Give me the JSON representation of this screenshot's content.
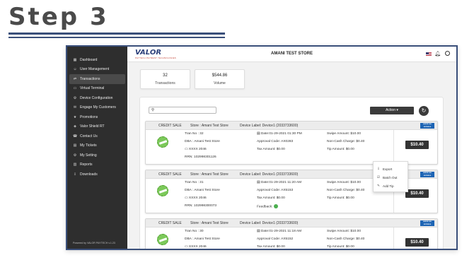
{
  "heading": "Step 3",
  "sidebar": {
    "items": [
      {
        "label": "Dashboard",
        "icon": "dashboard-icon",
        "glyph": "▦"
      },
      {
        "label": "User Management",
        "icon": "user-management-icon",
        "glyph": "☺"
      },
      {
        "label": "Transactions",
        "icon": "transactions-icon",
        "glyph": "⇄"
      },
      {
        "label": "Virtual Terminal",
        "icon": "virtual-terminal-icon",
        "glyph": "▭"
      },
      {
        "label": "Device Configuration",
        "icon": "device-icon",
        "glyph": "⚙"
      },
      {
        "label": "Engage My Customers",
        "icon": "engage-icon",
        "glyph": "✉"
      },
      {
        "label": "Promotions",
        "icon": "promotions-icon",
        "glyph": "★"
      },
      {
        "label": "Valor Shield RT",
        "icon": "shield-icon",
        "glyph": "◈"
      },
      {
        "label": "Contact Us",
        "icon": "contact-icon",
        "glyph": "☎"
      },
      {
        "label": "My Tickets",
        "icon": "tickets-icon",
        "glyph": "▤"
      },
      {
        "label": "My Setting",
        "icon": "settings-icon",
        "glyph": "⚙"
      },
      {
        "label": "Reports",
        "icon": "reports-icon",
        "glyph": "▥"
      },
      {
        "label": "Downloads",
        "icon": "download-icon",
        "glyph": "⇩"
      }
    ],
    "active_index": 2,
    "footer": "Powered by VALOR PAYTECH v.1.23"
  },
  "topbar": {
    "logo": "VALOR",
    "logo_sub": "PAYTECH PAYMENT TECHNOLOGIES",
    "store_name": "AMANI TEST STORE"
  },
  "stats": [
    {
      "value": "32",
      "label": "Transactions"
    },
    {
      "value": "$544.86",
      "label": "Volume"
    }
  ],
  "toolbar": {
    "search_placeholder": "",
    "action_label": "Action ▾"
  },
  "action_menu": [
    {
      "label": "Export",
      "icon": "export-icon",
      "glyph": "⇩"
    },
    {
      "label": "Batch Out",
      "icon": "batch-out-icon",
      "glyph": "☑"
    },
    {
      "label": "Add Tip",
      "icon": "add-tip-icon",
      "glyph": "✎"
    }
  ],
  "transactions": [
    {
      "type": "CREDIT SALE",
      "store": "Store : Amani Test Store",
      "device": "Device Label: Device1 (2033733600)",
      "tran_no": "Tran No : 32",
      "dba": "DBA : Amani Test Store",
      "card": "XXXX 2046",
      "rrn": "RRN: 102998301126",
      "date": "Date:01-29-2021 01:30 PM",
      "approval": "Approval Code: AX0283",
      "tax": "Tax Amount: $0.00",
      "feedback": "",
      "swipe": "Swipe Amount: $10.00",
      "noncash": "Non-Cash Charge: $0.40",
      "tip": "Tip Amount: $0.00",
      "total": "$10.40",
      "badge": "AMERICAN EXPRESS"
    },
    {
      "type": "CREDIT SALE",
      "store": "Store : Amani Test Store",
      "device": "Device Label: Device1 (2033733600)",
      "tran_no": "Tran No : 31",
      "dba": "DBA : Amani Test Store",
      "card": "XXXX 2046",
      "rrn": "RRN: 102998300073",
      "date": "Date:01-29-2021 11:20 AM",
      "approval": "Approval Code: AX5153",
      "tax": "Tax Amount: $0.00",
      "feedback": "Feedback:",
      "swipe": "Swipe Amount: $10.00",
      "noncash": "Non-Cash Charge: $0.40",
      "tip": "Tip Amount: $0.00",
      "total": "$10.40",
      "badge": "AMERICAN EXPRESS"
    },
    {
      "type": "CREDIT SALE",
      "store": "Store : Amani Test Store",
      "device": "Device Label: Device1 (2033733600)",
      "tran_no": "Tran No : 30",
      "dba": "DBA : Amani Test Store",
      "card": "XXXX 2046",
      "rrn": "",
      "date": "Date:01-29-2021 11:18 AM",
      "approval": "Approval Code: AX5152",
      "tax": "Tax Amount: $0.00",
      "feedback": "",
      "swipe": "Swipe Amount: $10.00",
      "noncash": "Non-Cash Charge: $0.40",
      "tip": "Tip Amount: $0.00",
      "total": "$10.40",
      "badge": "AMERICAN EXPRESS"
    }
  ],
  "colors": {
    "sidebar": "#2e2e2e",
    "accent": "#3a4f7a",
    "button": "#333333",
    "amex": "#1d64b4",
    "seal": "#7cc95a"
  }
}
